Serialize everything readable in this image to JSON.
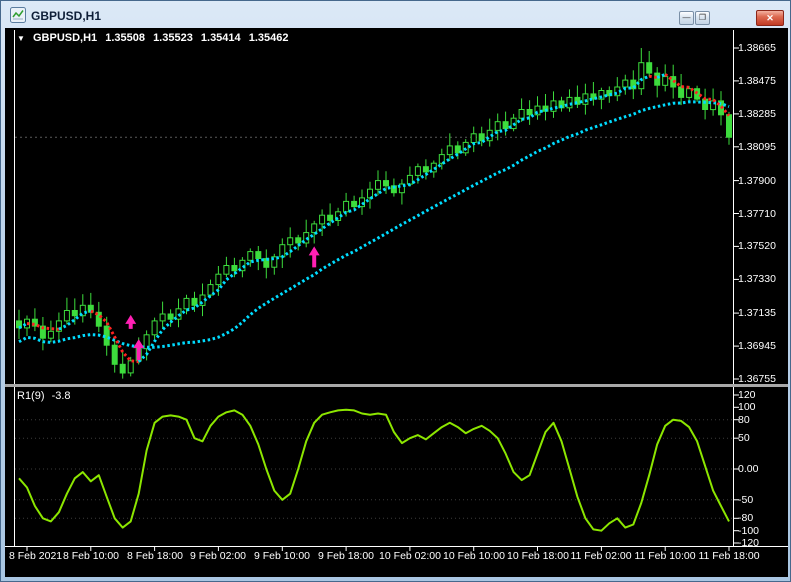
{
  "window": {
    "title": "GBPUSD,H1",
    "controls": {
      "minimize": "—",
      "maximize": "❐",
      "close": "✕"
    }
  },
  "quote_bar": {
    "dropdown_icon": "▼",
    "symbol": "GBPUSD,H1",
    "open": "1.35508",
    "high": "1.35523",
    "low": "1.35414",
    "close": "1.35462"
  },
  "price_axis": {
    "labels": [
      "1.38665",
      "1.38475",
      "1.38285",
      "1.38095",
      "1.37900",
      "1.37710",
      "1.37520",
      "1.37330",
      "1.37135",
      "1.36945",
      "1.36755"
    ]
  },
  "indicator": {
    "label": "R1(9)",
    "value": "-3.8",
    "axis_labels": [
      "120",
      "100",
      "80",
      "50",
      "0.00",
      "-50",
      "-80",
      "-100",
      "-120"
    ],
    "levels": [
      80,
      50,
      0,
      -50,
      -80
    ]
  },
  "time_axis": {
    "labels": [
      {
        "text": "8 Feb 2021",
        "bar": 1
      },
      {
        "text": "8 Feb 10:00",
        "bar": 9
      },
      {
        "text": "8 Feb 18:00",
        "bar": 17
      },
      {
        "text": "9 Feb 02:00",
        "bar": 25
      },
      {
        "text": "9 Feb 10:00",
        "bar": 33
      },
      {
        "text": "9 Feb 18:00",
        "bar": 41
      },
      {
        "text": "10 Feb 02:00",
        "bar": 49
      },
      {
        "text": "10 Feb 10:00",
        "bar": 57
      },
      {
        "text": "10 Feb 18:00",
        "bar": 65
      },
      {
        "text": "11 Feb 02:00",
        "bar": 73
      },
      {
        "text": "11 Feb 10:00",
        "bar": 81
      },
      {
        "text": "11 Feb 18:00",
        "bar": 89
      }
    ]
  },
  "colors": {
    "background": "#000000",
    "axis_text": "#ffffff",
    "candle": "#3ddc3d",
    "dots_up": "#00dcff",
    "dots_down": "#ff2222",
    "arrow": "#ff20b4",
    "oscillator": "#8ce600",
    "levels": "#3c3c3c",
    "bid_line": "#5a5a5a",
    "frame_line": "#ffffff",
    "splitter": "#a8a8a8"
  },
  "chart_data": {
    "type": "candlestick",
    "symbol": "GBPUSD",
    "timeframe": "H1",
    "title": "GBPUSD,H1",
    "ylim": [
      1.36755,
      1.38665
    ],
    "closes": [
      1.3705,
      1.371,
      1.3706,
      1.3699,
      1.3703,
      1.3709,
      1.3715,
      1.3712,
      1.3718,
      1.3714,
      1.3706,
      1.3695,
      1.3684,
      1.3679,
      1.3686,
      1.3693,
      1.3701,
      1.3709,
      1.3713,
      1.371,
      1.3716,
      1.3722,
      1.3718,
      1.3724,
      1.373,
      1.3736,
      1.3741,
      1.3738,
      1.3744,
      1.3749,
      1.3745,
      1.374,
      1.3746,
      1.3753,
      1.3757,
      1.3754,
      1.376,
      1.3765,
      1.377,
      1.3767,
      1.3772,
      1.3778,
      1.3775,
      1.378,
      1.3785,
      1.379,
      1.3787,
      1.3783,
      1.3788,
      1.3793,
      1.3798,
      1.3795,
      1.38,
      1.3805,
      1.381,
      1.3806,
      1.3812,
      1.3817,
      1.3813,
      1.3819,
      1.3824,
      1.382,
      1.3826,
      1.3831,
      1.3828,
      1.3833,
      1.383,
      1.3836,
      1.3832,
      1.3838,
      1.3834,
      1.384,
      1.3837,
      1.3842,
      1.3839,
      1.3844,
      1.3848,
      1.3843,
      1.3858,
      1.3852,
      1.3845,
      1.385,
      1.3844,
      1.3838,
      1.3843,
      1.3837,
      1.3831,
      1.3836,
      1.3828,
      1.3815
    ],
    "high_spike": {
      "bar": 78,
      "price": 1.38665
    },
    "low_spike": {
      "bar": 13,
      "price": 1.36758
    },
    "overlays": {
      "fast_dotted": {
        "period": 4,
        "up_color": "#00dcff",
        "down_color": "#ff2222"
      },
      "slow_dotted": {
        "period": 16,
        "offset": -0.0008,
        "color": "#00dcff"
      },
      "arrows": [
        {
          "bar": 14,
          "price": 1.37125,
          "size": 14
        },
        {
          "bar": 15,
          "price": 1.36985,
          "size": 21
        },
        {
          "bar": 37,
          "price": 1.3752,
          "size": 21
        }
      ]
    },
    "oscillator": {
      "name": "R1(9)",
      "last_value": -3.8,
      "range": [
        -120,
        120
      ],
      "values": [
        -15,
        -30,
        -60,
        -80,
        -85,
        -70,
        -40,
        -15,
        -5,
        -20,
        -10,
        -45,
        -80,
        -95,
        -85,
        -40,
        30,
        75,
        85,
        87,
        85,
        80,
        50,
        45,
        70,
        85,
        92,
        95,
        88,
        70,
        40,
        0,
        -35,
        -50,
        -40,
        0,
        45,
        75,
        88,
        92,
        95,
        96,
        95,
        90,
        88,
        90,
        88,
        60,
        42,
        50,
        55,
        48,
        58,
        68,
        75,
        68,
        58,
        65,
        70,
        62,
        50,
        25,
        -5,
        -18,
        -10,
        25,
        60,
        75,
        45,
        0,
        -45,
        -80,
        -98,
        -100,
        -88,
        -80,
        -95,
        -90,
        -55,
        -10,
        40,
        70,
        80,
        78,
        68,
        45,
        5,
        -35,
        -60,
        -85
      ]
    }
  }
}
